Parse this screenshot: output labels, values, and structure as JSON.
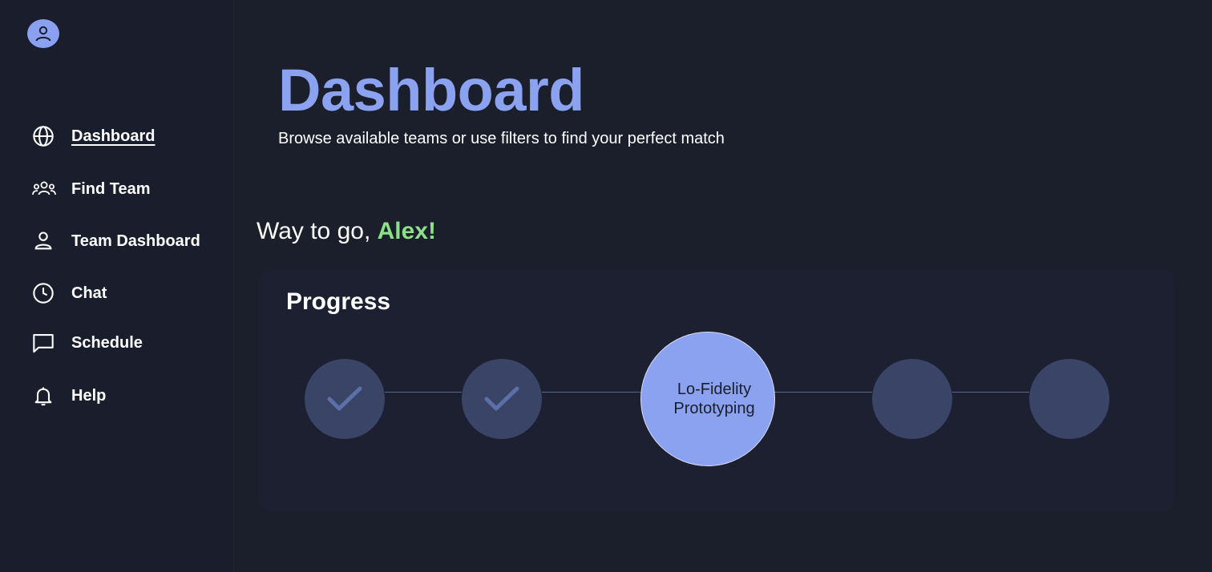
{
  "sidebar": {
    "avatar_icon": "user-icon",
    "items": [
      {
        "label": "Dashboard",
        "icon": "globe-icon",
        "active": true
      },
      {
        "label": "Find Team",
        "icon": "users-icon",
        "active": false
      },
      {
        "label": "Team Dashboard",
        "icon": "person-icon",
        "active": false
      },
      {
        "label": "Chat",
        "icon": "clock-icon",
        "active": false
      },
      {
        "label": "Schedule",
        "icon": "message-icon",
        "active": false
      },
      {
        "label": "Help",
        "icon": "bell-icon",
        "active": false
      }
    ]
  },
  "header": {
    "title": "Dashboard",
    "subtitle": "Browse available teams or use filters to find your perfect match"
  },
  "greeting": {
    "prefix": "Way to go, ",
    "name": "Alex!"
  },
  "progress": {
    "title": "Progress",
    "steps": [
      {
        "state": "completed",
        "icon": "check-icon",
        "label": ""
      },
      {
        "state": "completed",
        "icon": "check-icon",
        "label": ""
      },
      {
        "state": "current",
        "label_line1": "Lo-Fidelity",
        "label_line2": "Prototyping"
      },
      {
        "state": "upcoming",
        "label": ""
      },
      {
        "state": "upcoming",
        "label": ""
      }
    ]
  },
  "colors": {
    "accent": "#8aa2ef",
    "highlight_name": "#8de08a",
    "background": "#1b1e2b",
    "step_inactive": "#3a4466"
  }
}
